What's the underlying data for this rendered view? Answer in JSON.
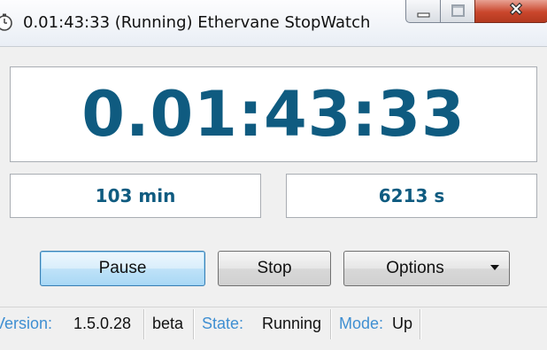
{
  "window": {
    "title": "0.01:43:33 (Running) Ethervane StopWatch"
  },
  "display": {
    "main_time": "0.01:43:33",
    "minutes": "103 min",
    "seconds": "6213 s"
  },
  "buttons": {
    "pause": "Pause",
    "stop": "Stop",
    "options": "Options"
  },
  "status": {
    "version_label": "Version:",
    "version_value": "1.5.0.28",
    "channel": "beta",
    "state_label": "State:",
    "state_value": "Running",
    "mode_label": "Mode:",
    "mode_value": "Up"
  },
  "colors": {
    "display_text": "#0f5b80",
    "status_key": "#3f8fd2"
  },
  "icons": [
    "stopwatch-icon",
    "minimize-icon",
    "maximize-icon",
    "close-icon",
    "dropdown-arrow-icon"
  ]
}
